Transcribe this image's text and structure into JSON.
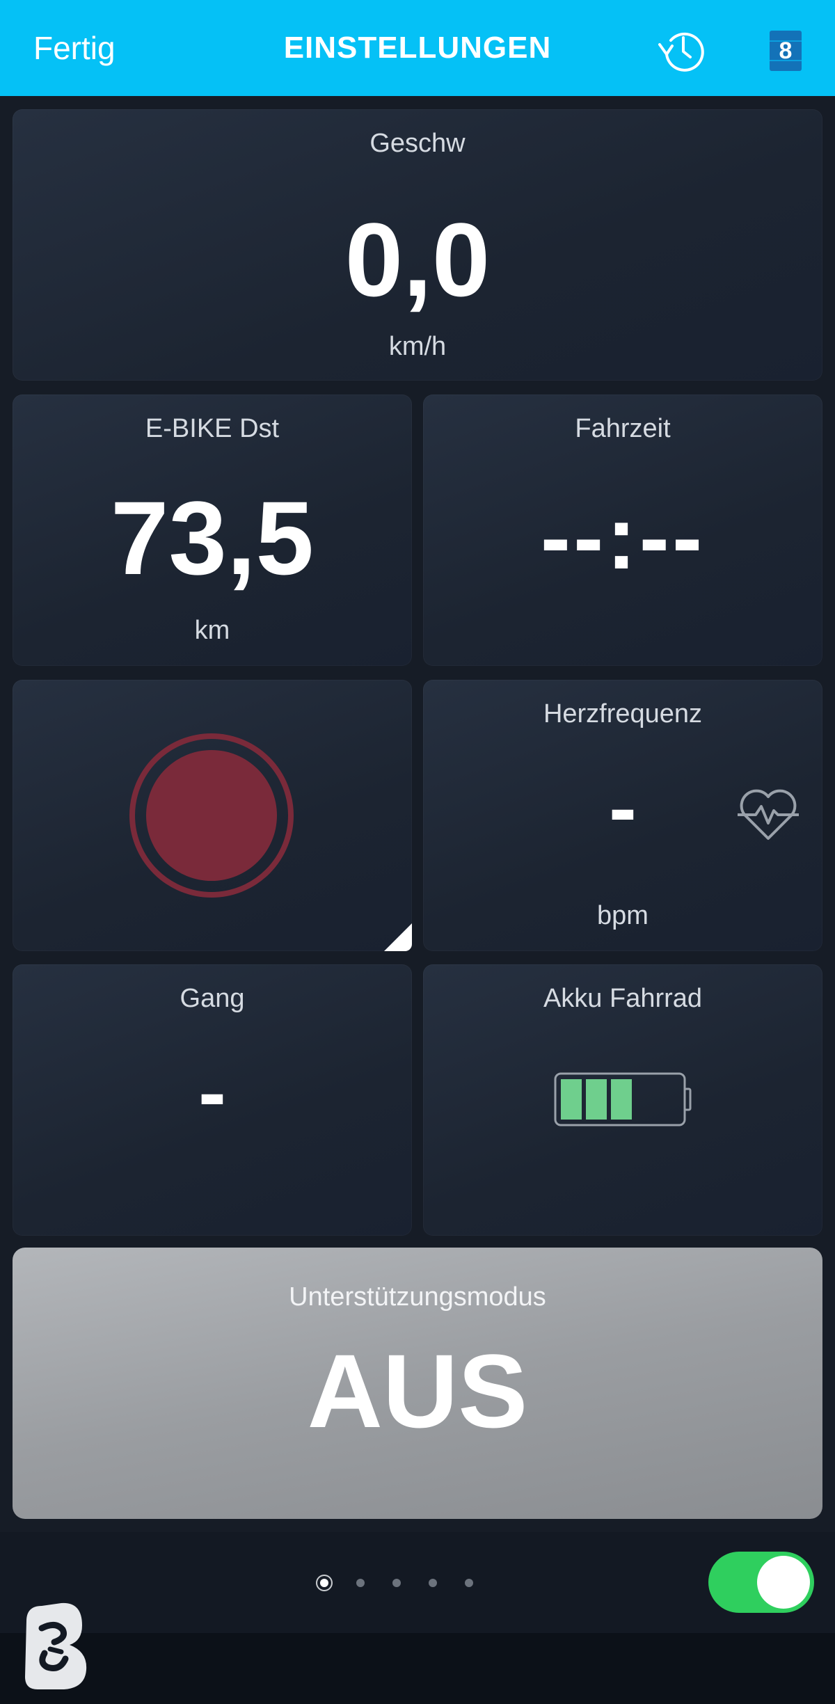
{
  "header": {
    "done_label": "Fertig",
    "title": "EINSTELLUNGEN",
    "history_icon": "history-clock-icon",
    "page_number": "8",
    "background_color": "#05c1f6"
  },
  "tiles": {
    "speed": {
      "label": "Geschw",
      "value": "0,0",
      "unit": "km/h"
    },
    "distance": {
      "label": "E-BIKE Dst",
      "value": "73,5",
      "unit": "km"
    },
    "ride_time": {
      "label": "Fahrzeit",
      "value": "--:--"
    },
    "record": {
      "icon": "record-button-icon",
      "color": "#7a2a3a"
    },
    "heart_rate": {
      "label": "Herzfrequenz",
      "value": "-",
      "unit": "bpm",
      "icon": "heart-pulse-icon"
    },
    "gear": {
      "label": "Gang",
      "value": "-"
    },
    "battery": {
      "label": "Akku Fahrrad",
      "icon": "battery-icon",
      "bars_filled": 3,
      "bars_total": 5,
      "color": "#6fcf8d"
    }
  },
  "assist_mode": {
    "label": "Unterstützungsmodus",
    "value": "AUS"
  },
  "footer": {
    "pages": 5,
    "active_page": 1,
    "toggle_on": true,
    "toggle_color": "#2fcf5e",
    "logo_icon": "app-logo-icon"
  }
}
